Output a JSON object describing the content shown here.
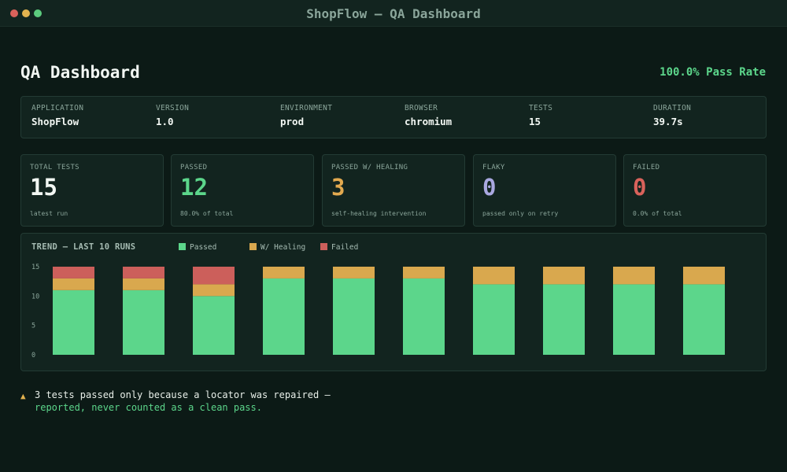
{
  "window": {
    "title": "ShopFlow — QA Dashboard"
  },
  "header": {
    "title": "QA Dashboard",
    "pass_rate": "100.0% Pass Rate"
  },
  "meta": [
    {
      "label": "APPLICATION",
      "value": "ShopFlow"
    },
    {
      "label": "VERSION",
      "value": "1.0"
    },
    {
      "label": "ENVIRONMENT",
      "value": "prod"
    },
    {
      "label": "BROWSER",
      "value": "chromium"
    },
    {
      "label": "TESTS",
      "value": "15"
    },
    {
      "label": "DURATION",
      "value": "39.7s"
    }
  ],
  "stats": [
    {
      "label": "TOTAL TESTS",
      "value": "15",
      "sub": "latest run",
      "color": "#f2f7f3"
    },
    {
      "label": "PASSED",
      "value": "12",
      "sub": "80.0% of total",
      "color": "#5cd68b"
    },
    {
      "label": "PASSED W/ HEALING",
      "value": "3",
      "sub": "self-healing intervention",
      "color": "#e2a94f"
    },
    {
      "label": "FLAKY",
      "value": "0",
      "sub": "passed only on retry",
      "color": "#a9a8e0"
    },
    {
      "label": "FAILED",
      "value": "0",
      "sub": "0.0% of total",
      "color": "#d9625b"
    }
  ],
  "chart_data": {
    "type": "bar",
    "stacked": true,
    "title": "TREND — LAST 10 RUNS",
    "categories": [
      "",
      "",
      "",
      "",
      "",
      "",
      "",
      "",
      "",
      ""
    ],
    "series": [
      {
        "name": "Passed",
        "color": "#5cd68b",
        "values": [
          11,
          11,
          10,
          13,
          13,
          13,
          12,
          12,
          12,
          12
        ]
      },
      {
        "name": "W/ Healing",
        "color": "#d9a84e",
        "values": [
          2,
          2,
          2,
          2,
          2,
          2,
          3,
          3,
          3,
          3
        ]
      },
      {
        "name": "Failed",
        "color": "#cc5f5b",
        "values": [
          2,
          2,
          3,
          0,
          0,
          0,
          0,
          0,
          0,
          0
        ]
      }
    ],
    "yticks": [
      "0",
      "5",
      "10",
      "15"
    ],
    "ylim": [
      0,
      15
    ],
    "grid": false,
    "legend": "top"
  },
  "footnote": {
    "icon": "warning-icon",
    "line1": "3 tests passed only because a locator was repaired —",
    "line2": "reported, never counted as a clean pass."
  }
}
